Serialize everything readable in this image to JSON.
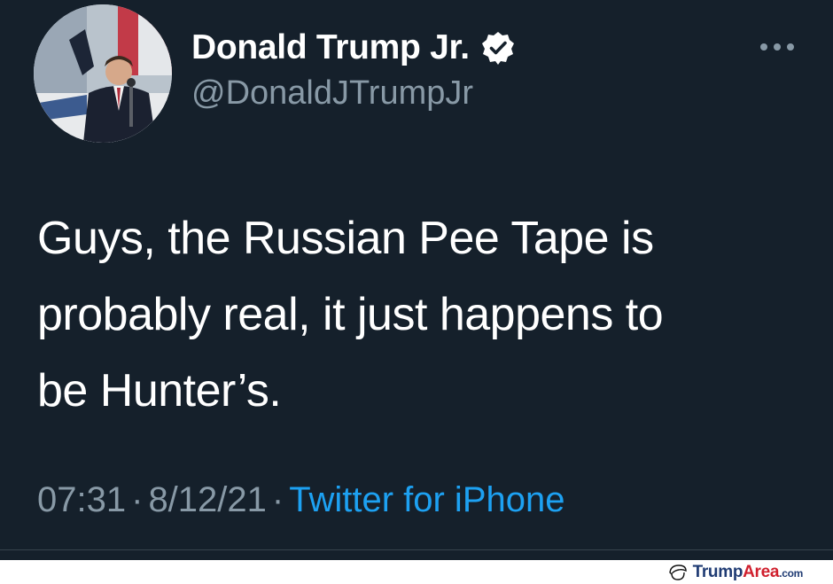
{
  "tweet": {
    "display_name": "Donald Trump Jr.",
    "handle": "@DonaldJTrumpJr",
    "verified_icon": "verified-badge-icon",
    "more_icon": "more-options-icon",
    "text_lines": [
      "Guys, the Russian Pee Tape is",
      "probably real, it just happens to",
      "be Hunter’s."
    ],
    "time": "07:31",
    "separator": "·",
    "date": "8/12/21",
    "source": "Twitter for iPhone"
  },
  "watermark": {
    "part1": "Trump",
    "part2": "Area",
    "part3": ".com"
  },
  "colors": {
    "background": "#15202b",
    "primary_text": "#ffffff",
    "secondary_text": "#8899a6",
    "link": "#1da1f2"
  }
}
